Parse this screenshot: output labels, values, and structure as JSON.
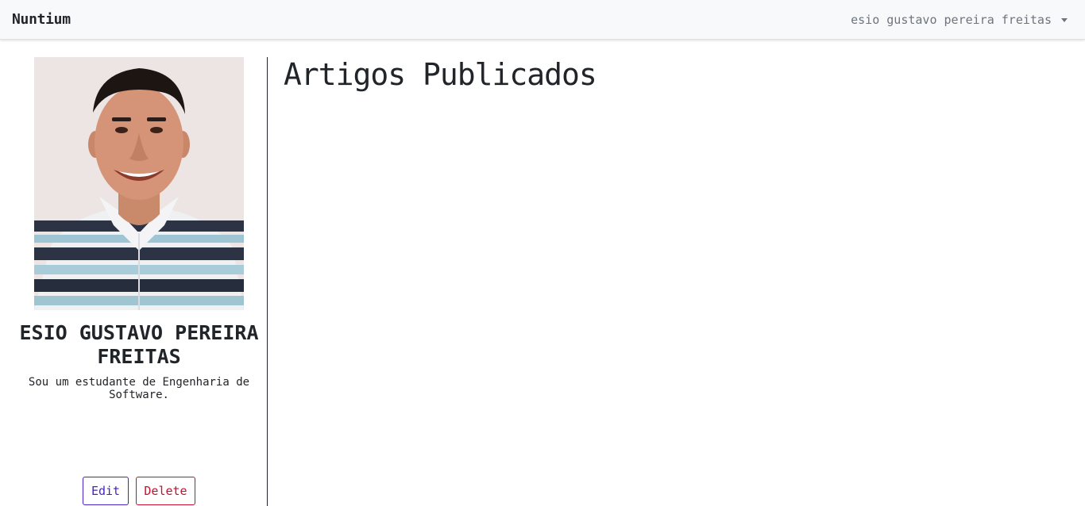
{
  "navbar": {
    "brand": "Nuntium",
    "user_name": "esio gustavo pereira freitas"
  },
  "profile": {
    "name": "ESIO GUSTAVO PEREIRA FREITAS",
    "bio": "Sou um estudante de Engenharia de Software.",
    "edit_label": "Edit",
    "delete_label": "Delete"
  },
  "main": {
    "title": "Artigos Publicados"
  },
  "colors": {
    "navbar_bg": "#f8f9fa",
    "edit_accent": "#4a1fc7",
    "delete_accent": "#c8102e"
  }
}
